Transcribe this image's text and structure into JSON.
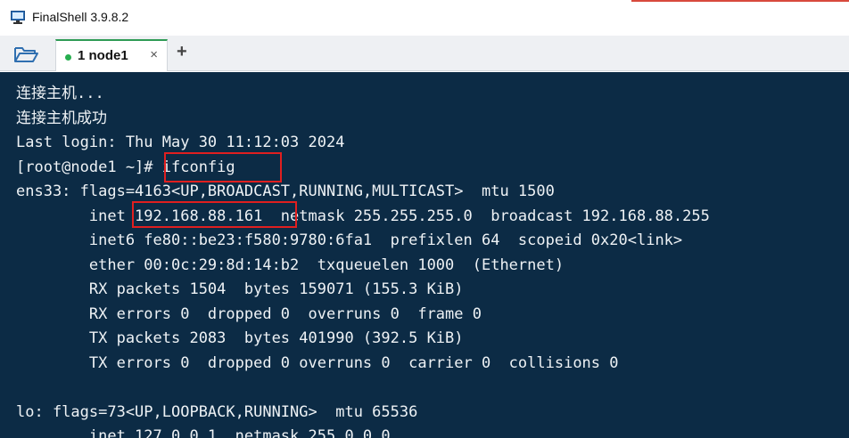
{
  "window": {
    "title": "FinalShell 3.9.8.2",
    "accent_color": "#d84a3d"
  },
  "tabs": {
    "folder_icon": "folder-open-icon",
    "items": [
      {
        "label": "1 node1",
        "status_color": "#27ae4f",
        "close_label": "×"
      }
    ],
    "add_label": "+"
  },
  "terminal": {
    "background": "#0c2b45",
    "lines": [
      "连接主机...",
      "连接主机成功",
      "Last login: Thu May 30 11:12:03 2024",
      "[root@node1 ~]# ifconfig",
      "ens33: flags=4163<UP,BROADCAST,RUNNING,MULTICAST>  mtu 1500",
      "        inet 192.168.88.161  netmask 255.255.255.0  broadcast 192.168.88.255",
      "        inet6 fe80::be23:f580:9780:6fa1  prefixlen 64  scopeid 0x20<link>",
      "        ether 00:0c:29:8d:14:b2  txqueuelen 1000  (Ethernet)",
      "        RX packets 1504  bytes 159071 (155.3 KiB)",
      "        RX errors 0  dropped 0  overruns 0  frame 0",
      "        TX packets 2083  bytes 401990 (392.5 KiB)",
      "        TX errors 0  dropped 0 overruns 0  carrier 0  collisions 0",
      "",
      "lo: flags=73<UP,LOOPBACK,RUNNING>  mtu 65536",
      "        inet 127.0.0.1  netmask 255.0.0.0"
    ],
    "highlight_color": "#e01f1f",
    "highlights": [
      "ifconfig",
      "192.168.88.161"
    ]
  }
}
